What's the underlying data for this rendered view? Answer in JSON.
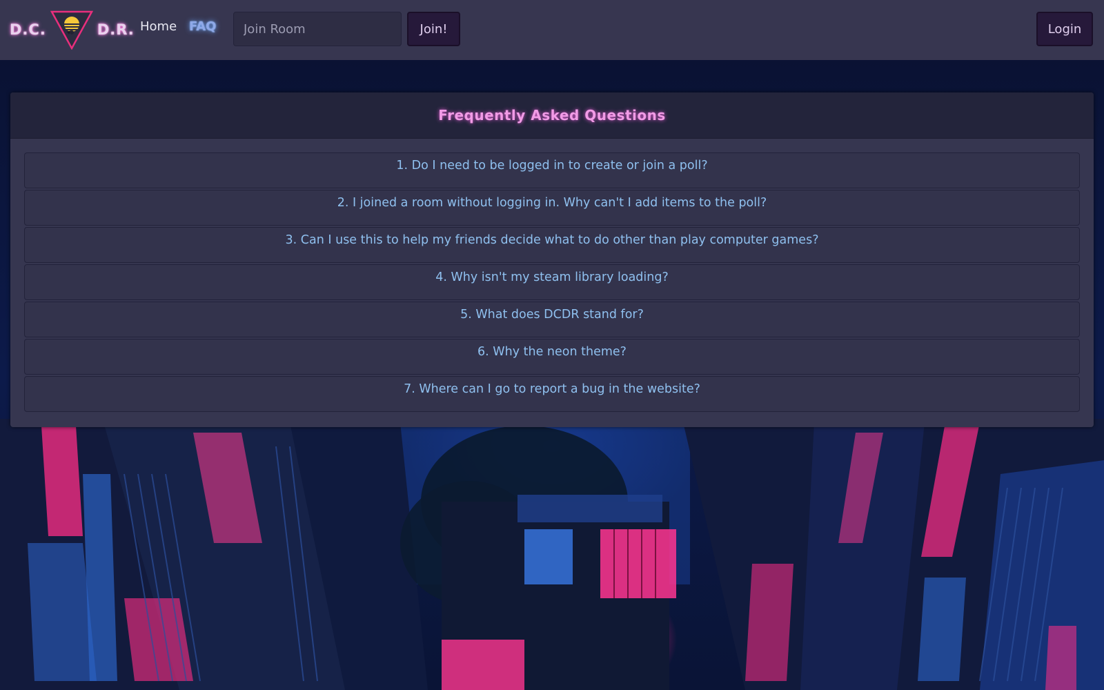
{
  "navbar": {
    "brand_left": "D.C.",
    "brand_right": "D.R.",
    "logo_icon": "retro-sunset-triangle-icon",
    "links": [
      {
        "label": "Home"
      },
      {
        "label": "FAQ"
      }
    ],
    "join_input": {
      "value": "",
      "placeholder": "Join Room"
    },
    "join_button_label": "Join!",
    "login_button_label": "Login"
  },
  "faq": {
    "title": "Frequently Asked Questions",
    "questions": [
      "1. Do I need to be logged in to create or join a poll?",
      "2. I joined a room without logging in. Why can't I add items to the poll?",
      "3. Can I use this to help my friends decide what to do other than play computer games?",
      "4. Why isn't my steam library loading?",
      "5. What does DCDR stand for?",
      "6. Why the neon theme?",
      "7. Where can I go to report a bug in the website?"
    ]
  },
  "colors": {
    "navbar_bg": "#373650",
    "card_bg": "#363650",
    "header_bg": "#23243b",
    "title_pink": "#f19be6",
    "question_blue": "#8fc0ef",
    "button_bg": "#26193a",
    "neon_pink": "#ff2d8a",
    "neon_blue": "#2f7bff"
  },
  "background": {
    "description_icon": "neon-city-alley-background"
  }
}
